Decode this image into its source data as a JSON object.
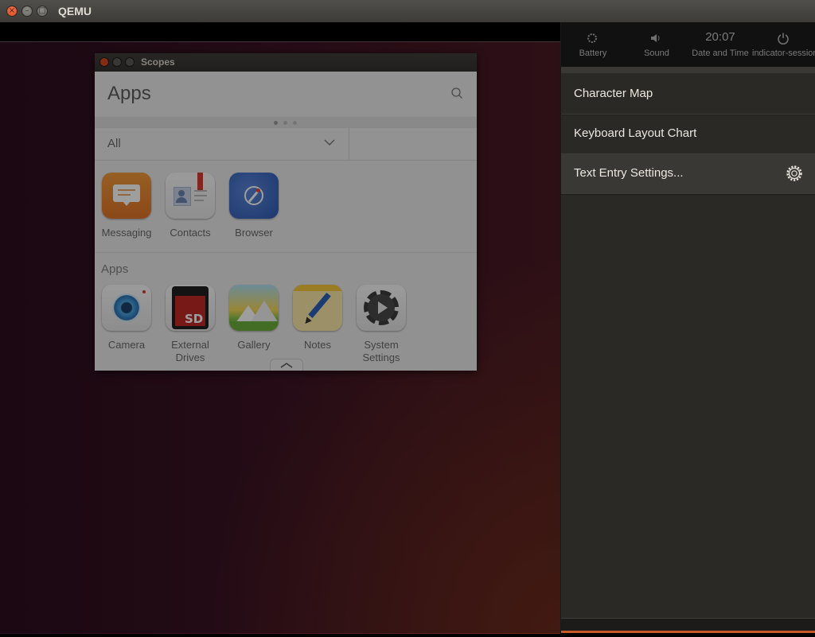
{
  "host_window": {
    "title": "QEMU"
  },
  "scopes_window": {
    "title": "Scopes",
    "header_title": "Apps",
    "filter_selected": "All",
    "favorites": [
      {
        "label": "Messaging",
        "icon": "messaging-icon"
      },
      {
        "label": "Contacts",
        "icon": "contacts-icon"
      },
      {
        "label": "Browser",
        "icon": "browser-icon"
      }
    ],
    "section_label": "Apps",
    "apps": [
      {
        "label": "Camera",
        "icon": "camera-icon"
      },
      {
        "label": "External\nDrives",
        "line1": "External",
        "line2": "Drives",
        "icon": "sd-card-icon"
      },
      {
        "label": "Gallery",
        "icon": "gallery-icon"
      },
      {
        "label": "Notes",
        "icon": "notes-icon"
      },
      {
        "label": "System\nSettings",
        "line1": "System",
        "line2": "Settings",
        "icon": "system-settings-icon"
      }
    ]
  },
  "indicators": [
    {
      "label": "Battery",
      "icon": "battery-icon"
    },
    {
      "label": "Sound",
      "icon": "sound-icon"
    },
    {
      "label": "Date and Time",
      "value": "20:07"
    },
    {
      "label": "indicator-session",
      "icon": "power-icon"
    }
  ],
  "menu": {
    "items": [
      {
        "label": "Character Map"
      },
      {
        "label": "Keyboard Layout Chart"
      },
      {
        "label": "Text Entry Settings...",
        "icon": "gear-icon"
      }
    ]
  },
  "colors": {
    "accent": "#c95a2a",
    "panel_bg": "#2b2926",
    "titlebar": "#3c3b37"
  }
}
